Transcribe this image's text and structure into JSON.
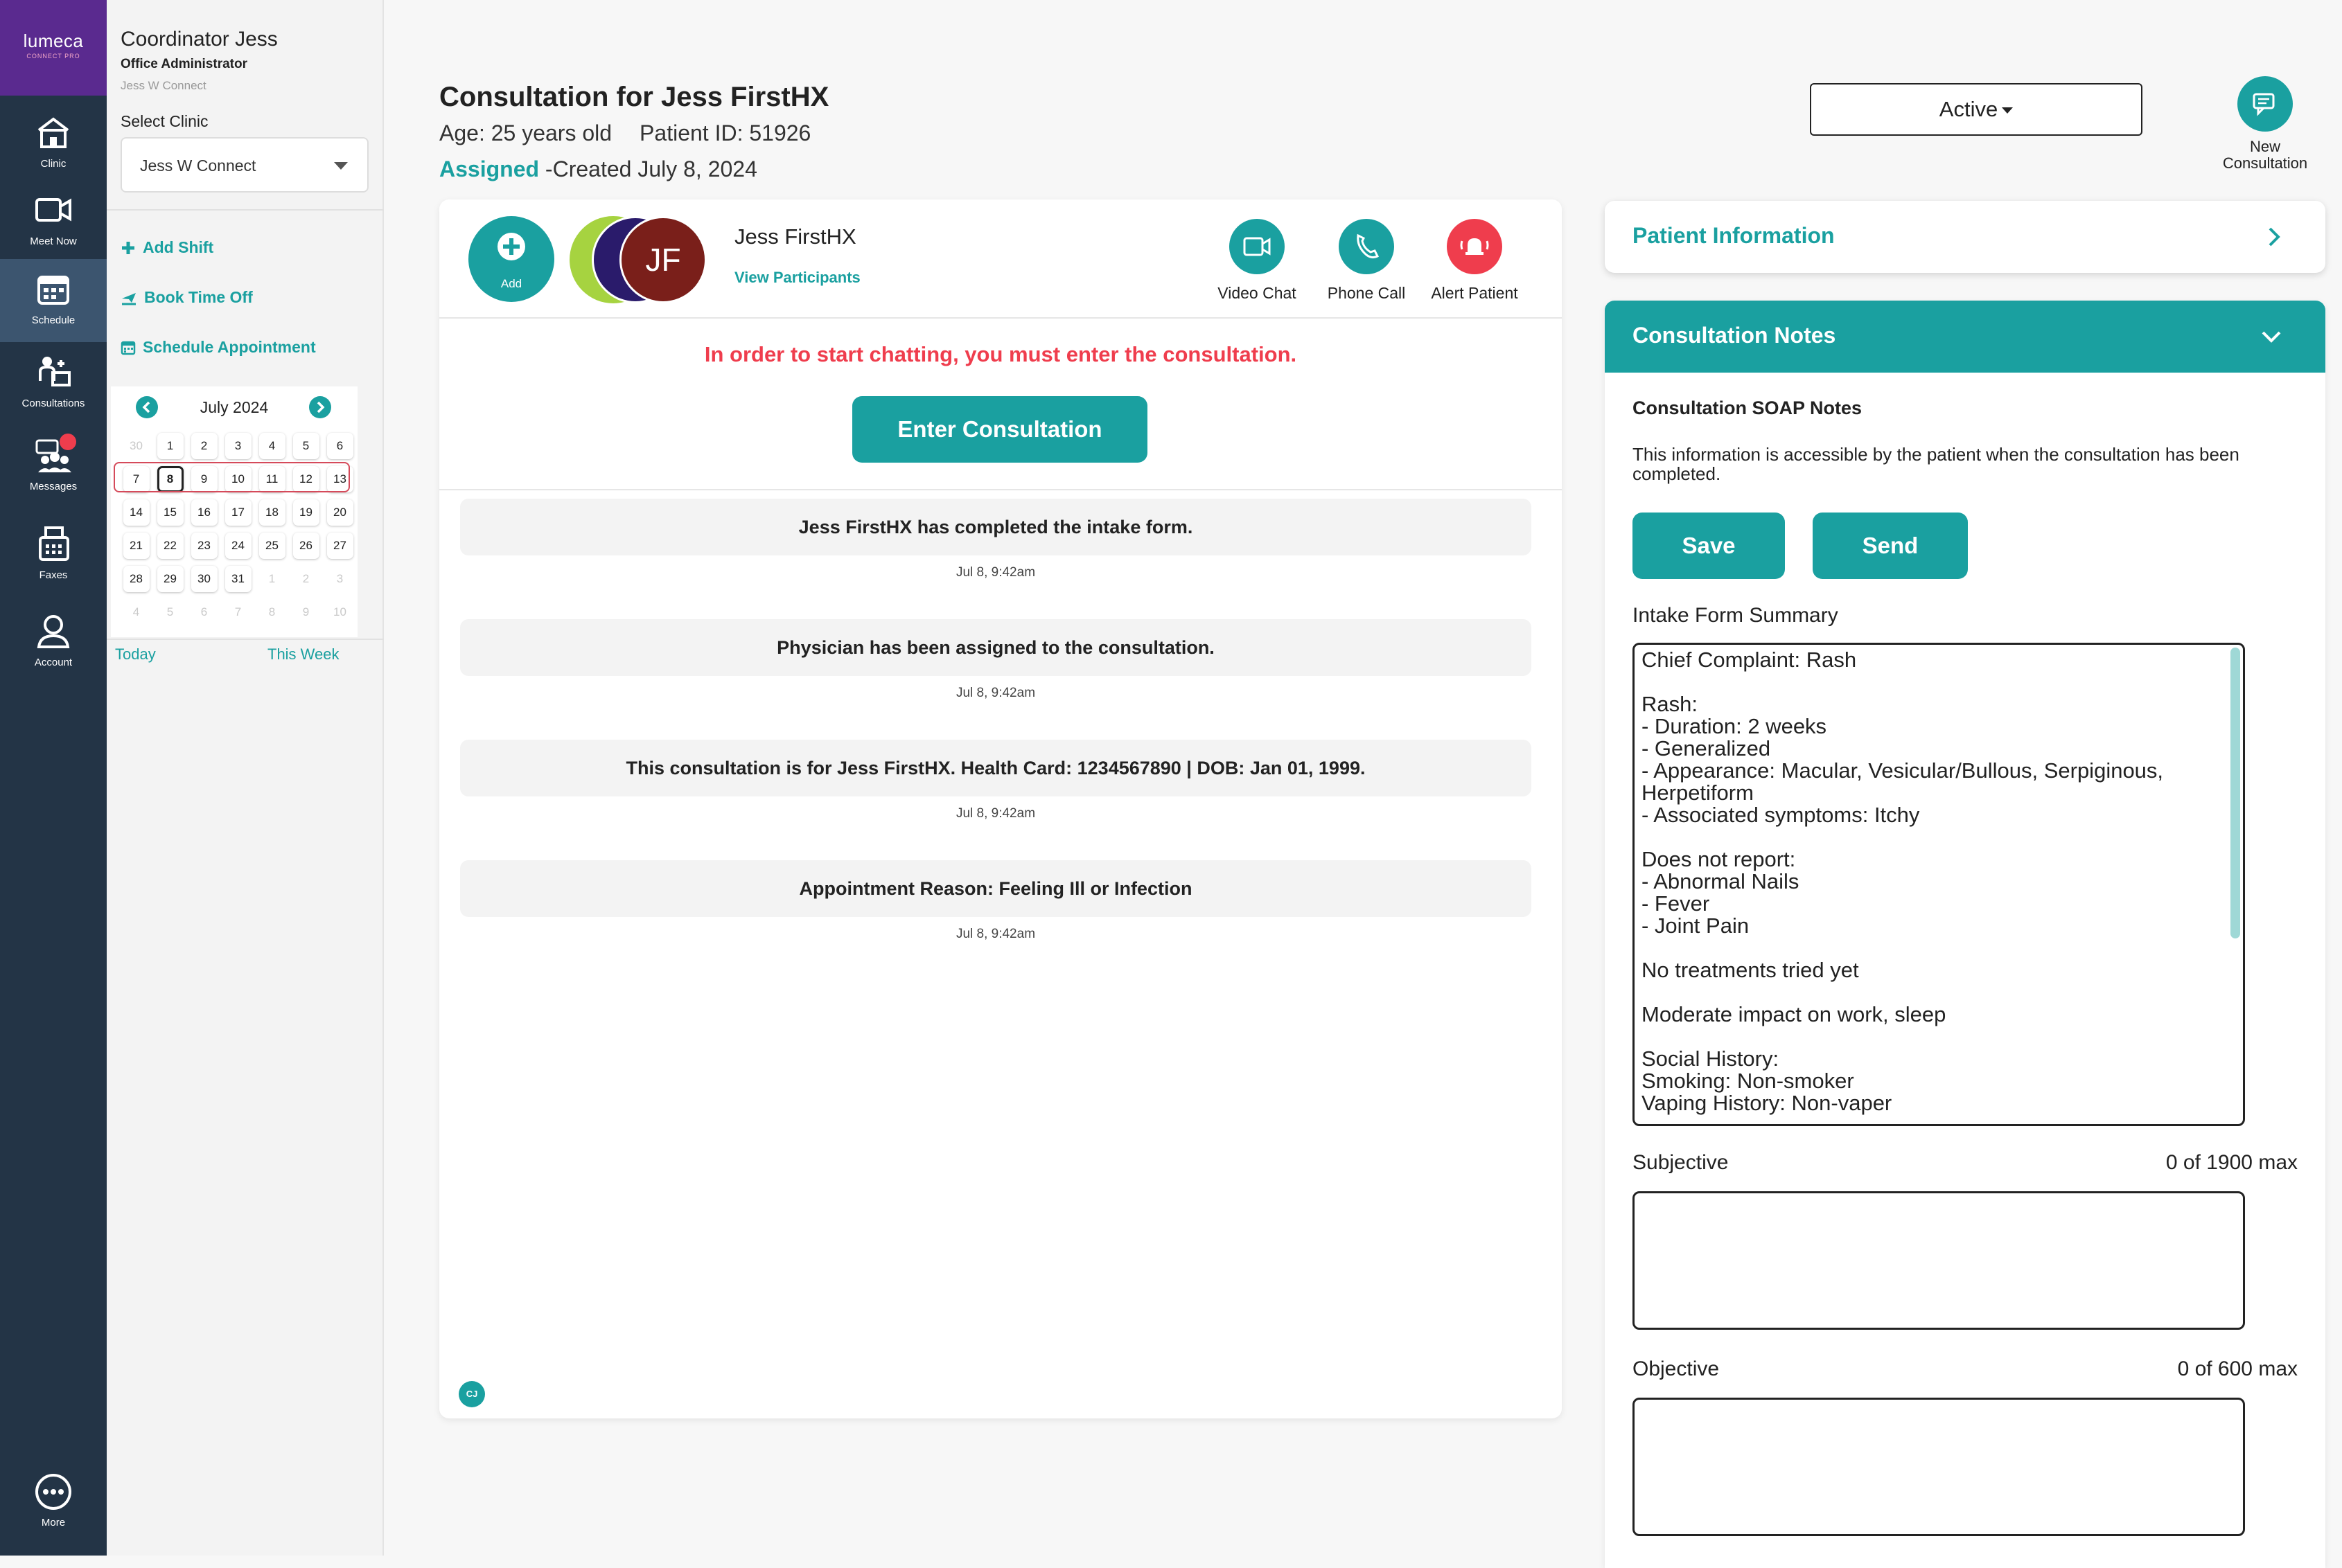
{
  "brand": {
    "name": "lumeca",
    "sub": "CONNECT PRO"
  },
  "nav": [
    {
      "label": "Clinic"
    },
    {
      "label": "Meet Now"
    },
    {
      "label": "Schedule"
    },
    {
      "label": "Consultations"
    },
    {
      "label": "Messages"
    },
    {
      "label": "Faxes"
    },
    {
      "label": "Account"
    },
    {
      "label": "More"
    }
  ],
  "user": {
    "name": "Coordinator Jess",
    "role": "Office Administrator",
    "clinic": "Jess W Connect"
  },
  "clinic_select": {
    "label": "Select Clinic",
    "value": "Jess W Connect"
  },
  "actions": {
    "add_shift": "Add Shift",
    "book_time_off": "Book Time Off",
    "schedule_appointment": "Schedule Appointment"
  },
  "calendar": {
    "month": "July 2024",
    "days": [
      "30",
      "1",
      "2",
      "3",
      "4",
      "5",
      "6",
      "7",
      "8",
      "9",
      "10",
      "11",
      "12",
      "13",
      "14",
      "15",
      "16",
      "17",
      "18",
      "19",
      "20",
      "21",
      "22",
      "23",
      "24",
      "25",
      "26",
      "27",
      "28",
      "29",
      "30",
      "31",
      "1",
      "2",
      "3",
      "4",
      "5",
      "6",
      "7",
      "8",
      "9",
      "10"
    ],
    "today_btn": "Today",
    "week_btn": "This Week"
  },
  "header": {
    "title": "Consultation for Jess FirstHX",
    "age": "Age: 25 years old",
    "patient_id": "Patient ID: 51926",
    "status": "Assigned",
    "created": " -Created July 8, 2024"
  },
  "status_select": {
    "value": "Active"
  },
  "new_consultation": {
    "label": "New Consultation"
  },
  "participants": {
    "add_label": "Add",
    "initials": "JF",
    "patient_name": "Jess FirstHX",
    "view_participants": "View Participants",
    "video_chat": "Video Chat",
    "phone_call": "Phone Call",
    "alert_patient": "Alert Patient"
  },
  "chat": {
    "warning": "In order to start chatting, you must enter the consultation.",
    "enter_button": "Enter Consultation",
    "messages": [
      {
        "text": "Jess FirstHX has completed the intake form.",
        "time": "Jul 8, 9:42am"
      },
      {
        "text": "Physician has been assigned to the consultation.",
        "time": "Jul 8, 9:42am"
      },
      {
        "text": "This consultation is for Jess FirstHX. Health Card: 1234567890 | DOB: Jan 01, 1999.",
        "time": "Jul 8, 9:42am"
      },
      {
        "text": "Appointment Reason: Feeling Ill or Infection",
        "time": "Jul 8, 9:42am"
      }
    ],
    "user_initials": "CJ"
  },
  "patient_info": {
    "title": "Patient Information"
  },
  "notes": {
    "title": "Consultation Notes",
    "soap_title": "Consultation SOAP Notes",
    "info": "This information is accessible by the patient when the consultation has been completed.",
    "save": "Save",
    "send": "Send",
    "intake_label": "Intake Form Summary",
    "intake_text": "Chief Complaint: Rash\n\nRash:\n- Duration: 2 weeks\n- Generalized\n- Appearance: Macular, Vesicular/Bullous, Serpiginous, Herpetiform\n- Associated symptoms: Itchy\n\nDoes not report:\n- Abnormal Nails\n- Fever\n- Joint Pain\n\nNo treatments tried yet\n\nModerate impact on work, sleep\n\nSocial History:\nSmoking: Non-smoker\nVaping History: Non-vaper",
    "subjective_label": "Subjective",
    "subjective_count": "0 of 1900 max",
    "objective_label": "Objective",
    "objective_count": "0 of 600 max"
  },
  "colors": {
    "accent": "#1aa0a0",
    "rail": "#233446",
    "brand": "#5a2a8f",
    "alert": "#ef3d4d"
  }
}
